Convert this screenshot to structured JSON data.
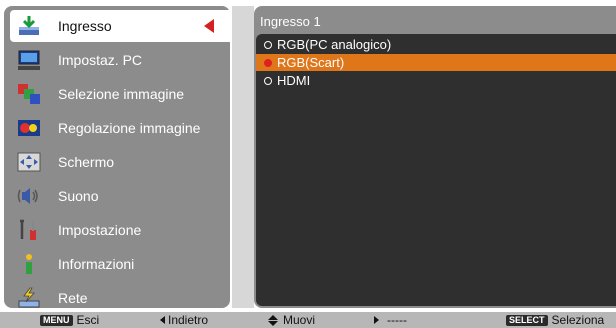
{
  "menu": {
    "items": [
      {
        "label": "Ingresso",
        "icon": "input-icon"
      },
      {
        "label": "Impostaz. PC",
        "icon": "pc-monitor-icon"
      },
      {
        "label": "Selezione immagine",
        "icon": "image-select-icon"
      },
      {
        "label": "Regolazione immagine",
        "icon": "image-adjust-icon"
      },
      {
        "label": "Schermo",
        "icon": "screen-icon"
      },
      {
        "label": "Suono",
        "icon": "sound-icon"
      },
      {
        "label": "Impostazione",
        "icon": "setting-tools-icon"
      },
      {
        "label": "Informazioni",
        "icon": "info-icon"
      },
      {
        "label": "Rete",
        "icon": "network-icon"
      }
    ],
    "selected_index": 0
  },
  "submenu": {
    "header": "Ingresso 1",
    "items": [
      {
        "label": "RGB(PC analogico)",
        "selected": false
      },
      {
        "label": "RGB(Scart)",
        "selected": true
      },
      {
        "label": "HDMI",
        "selected": false
      }
    ]
  },
  "footer": {
    "exit_key": "MENU",
    "exit_label": "Esci",
    "back_label": "Indietro",
    "move_label": "Muovi",
    "next_label": "-----",
    "select_key": "SELECT",
    "select_label": "Seleziona"
  },
  "colors": {
    "panel": "#8c8c8c",
    "list_bg": "#2f2f2f",
    "highlight": "#e0761a",
    "selector_arrow": "#d42020",
    "footer_bg": "#b7b7b7"
  }
}
